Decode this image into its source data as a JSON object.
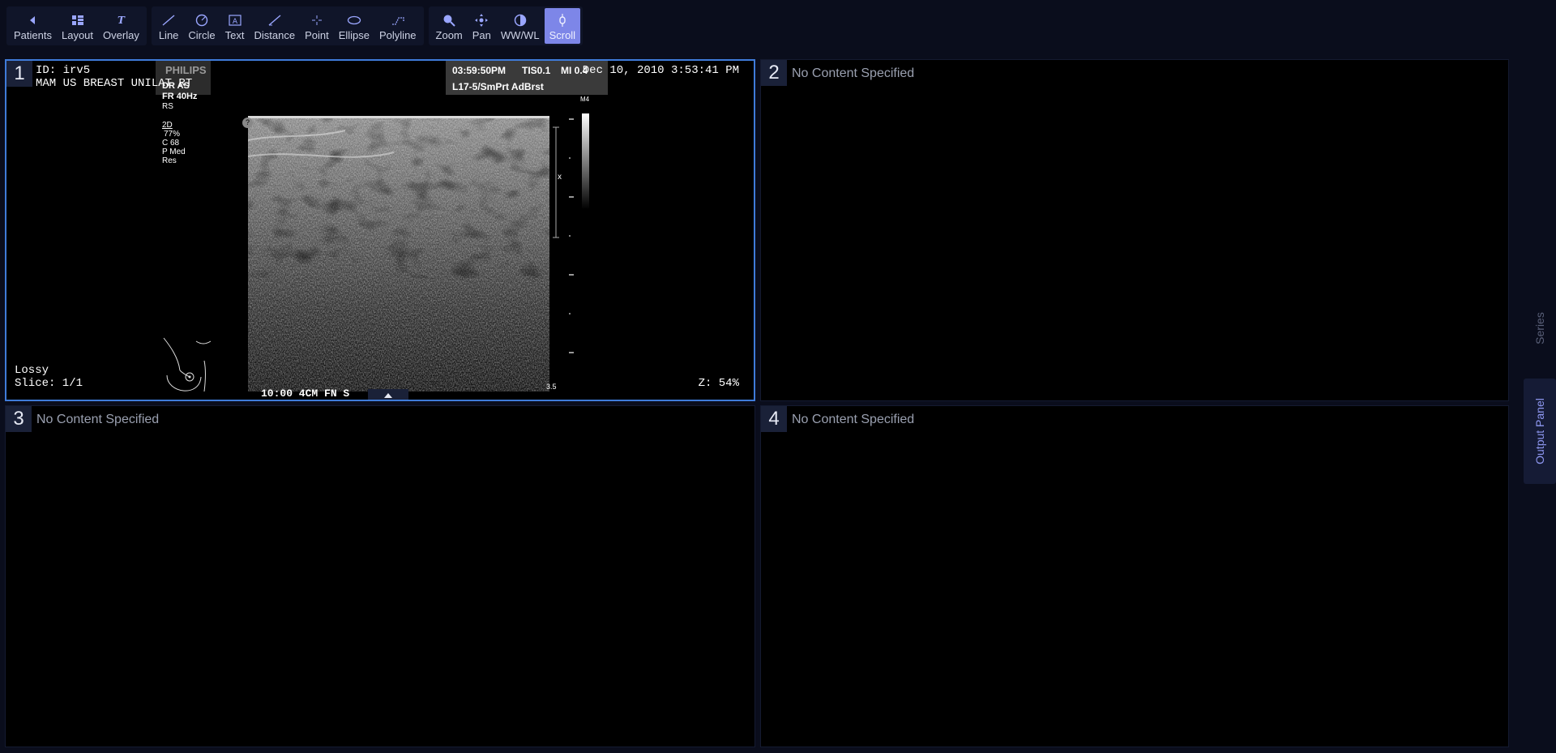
{
  "toolbar": {
    "groups": [
      [
        {
          "label": "Patients",
          "icon": "chevron-left-icon"
        },
        {
          "label": "Layout",
          "icon": "layout-grid-icon"
        },
        {
          "label": "Overlay",
          "icon": "overlay-text-icon"
        }
      ],
      [
        {
          "label": "Line",
          "icon": "line-icon"
        },
        {
          "label": "Circle",
          "icon": "circle-icon"
        },
        {
          "label": "Text",
          "icon": "text-icon"
        },
        {
          "label": "Distance",
          "icon": "distance-icon"
        },
        {
          "label": "Point",
          "icon": "point-icon"
        },
        {
          "label": "Ellipse",
          "icon": "ellipse-icon"
        },
        {
          "label": "Polyline",
          "icon": "polyline-icon"
        }
      ],
      [
        {
          "label": "Zoom",
          "icon": "zoom-icon"
        },
        {
          "label": "Pan",
          "icon": "pan-icon"
        },
        {
          "label": "WW/WL",
          "icon": "contrast-icon"
        },
        {
          "label": "Scroll",
          "icon": "scroll-icon",
          "active": true
        }
      ]
    ]
  },
  "viewports": {
    "vp1": {
      "number": "1",
      "id": "ID: irv5",
      "study": "MAM US BREAST UNILAT  RT",
      "date": "Dec 10, 2010 3:53:41 PM",
      "compression": "Lossy",
      "slice": "Slice: 1/1",
      "zoom": "Z: 54%",
      "us": {
        "brand": "PHILIPS",
        "time": "03:59:50PM",
        "tis": "TIS0.1",
        "mi": "MI 0.4",
        "probe": "L17-5/SmPrt AdBrst",
        "dr": "DR AS",
        "fr": "FR 40Hz",
        "rs": "RS",
        "mode": "2D",
        "gain": "77%",
        "c": "C 68",
        "p": "P Med",
        "res": "Res",
        "bottom": "10:00  4CM FN S",
        "depth": "3.5",
        "map": "M4",
        "marker_x": "x"
      }
    },
    "vp2": {
      "number": "2",
      "empty": "No Content Specified"
    },
    "vp3": {
      "number": "3",
      "empty": "No Content Specified"
    },
    "vp4": {
      "number": "4",
      "empty": "No Content Specified"
    }
  },
  "side_panel": {
    "series": "Series",
    "output": "Output Panel"
  },
  "colors": {
    "background": "#0a0d1c",
    "accent": "#7d86e8",
    "active_border": "#3f7bd9"
  }
}
